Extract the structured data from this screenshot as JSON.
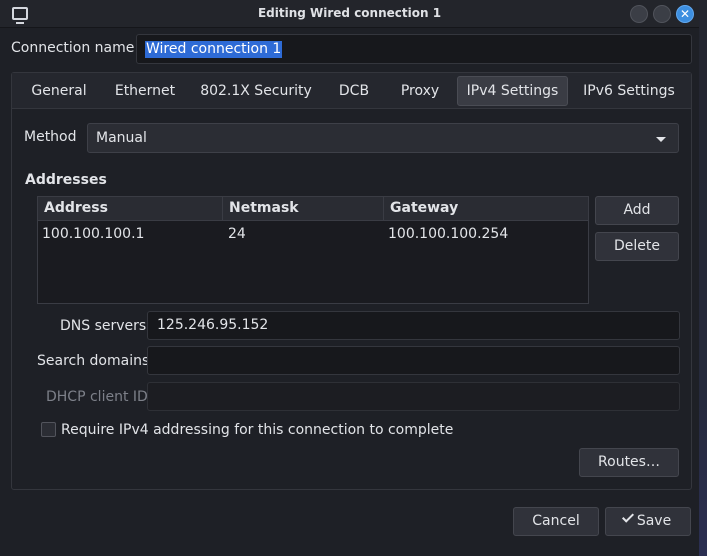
{
  "window": {
    "title": "Editing Wired connection 1",
    "close_glyph": "✕"
  },
  "connection": {
    "name_label": "Connection name",
    "name_value": "Wired connection 1"
  },
  "tabs": [
    {
      "label": "General"
    },
    {
      "label": "Ethernet"
    },
    {
      "label": "802.1X Security"
    },
    {
      "label": "DCB"
    },
    {
      "label": "Proxy"
    },
    {
      "label": "IPv4 Settings",
      "active": true
    },
    {
      "label": "IPv6 Settings"
    }
  ],
  "ipv4": {
    "method_label": "Method",
    "method_value": "Manual",
    "addresses_title": "Addresses",
    "columns": [
      "Address",
      "Netmask",
      "Gateway"
    ],
    "rows": [
      {
        "address": "100.100.100.1",
        "netmask": "24",
        "gateway": "100.100.100.254"
      }
    ],
    "add_label": "Add",
    "delete_label": "Delete",
    "dns_label": "DNS servers",
    "dns_value": "125.246.95.152",
    "search_label": "Search domains",
    "search_value": "",
    "dhcp_label": "DHCP client ID",
    "dhcp_value": "",
    "require_label": "Require IPv4 addressing for this connection to complete",
    "require_checked": false,
    "routes_label": "Routes…"
  },
  "footer": {
    "cancel_label": "Cancel",
    "save_label": "Save"
  },
  "colors": {
    "background": "#1e2026",
    "selection": "#2e6bd6",
    "close_button": "#3d8fe0"
  }
}
